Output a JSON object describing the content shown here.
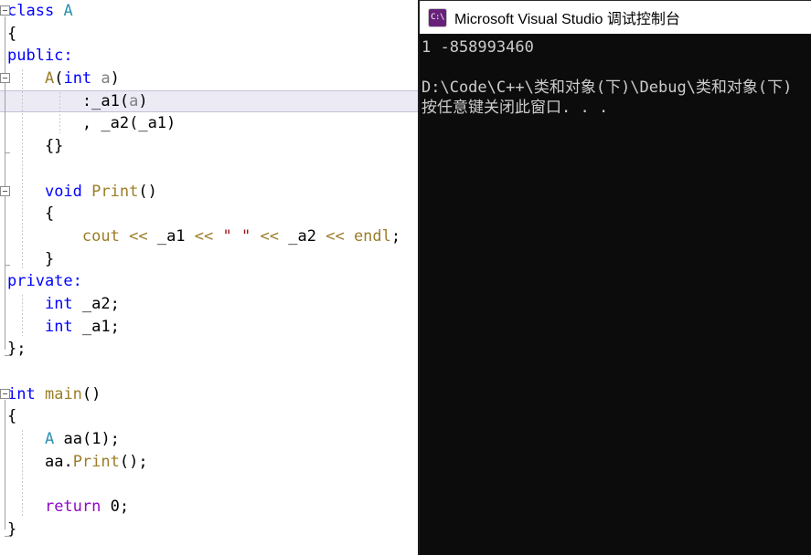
{
  "editor": {
    "name": "code-editor",
    "language": "cpp",
    "current_line_index": 4,
    "lines": [
      {
        "fold": "start",
        "indent": 0,
        "tokens": [
          {
            "t": "class",
            "c": "kw"
          },
          {
            "t": " ",
            "c": "plain"
          },
          {
            "t": "A",
            "c": "type"
          }
        ]
      },
      {
        "fold": "mid",
        "indent": 0,
        "tokens": [
          {
            "t": "{",
            "c": "plain"
          }
        ]
      },
      {
        "fold": "mid",
        "indent": 0,
        "tokens": [
          {
            "t": "public",
            "c": "kw"
          },
          {
            "t": ":",
            "c": "kw"
          }
        ]
      },
      {
        "fold": "start",
        "indent": 1,
        "tokens": [
          {
            "t": "    ",
            "c": "plain"
          },
          {
            "t": "A",
            "c": "fn"
          },
          {
            "t": "(",
            "c": "plain"
          },
          {
            "t": "int",
            "c": "kw"
          },
          {
            "t": " ",
            "c": "plain"
          },
          {
            "t": "a",
            "c": "param"
          },
          {
            "t": ")",
            "c": "plain"
          }
        ]
      },
      {
        "fold": "mid",
        "indent": 2,
        "tokens": [
          {
            "t": "        :",
            "c": "plain"
          },
          {
            "t": "_a1",
            "c": "plain"
          },
          {
            "t": "(",
            "c": "plain"
          },
          {
            "t": "a",
            "c": "param"
          },
          {
            "t": ")",
            "c": "plain"
          }
        ]
      },
      {
        "fold": "mid",
        "indent": 2,
        "tokens": [
          {
            "t": "        , ",
            "c": "plain"
          },
          {
            "t": "_a2",
            "c": "plain"
          },
          {
            "t": "(",
            "c": "plain"
          },
          {
            "t": "_a1",
            "c": "plain"
          },
          {
            "t": ")",
            "c": "plain"
          }
        ]
      },
      {
        "fold": "end",
        "indent": 1,
        "tokens": [
          {
            "t": "    {}",
            "c": "plain"
          }
        ]
      },
      {
        "fold": "mid",
        "indent": 1,
        "tokens": [
          {
            "t": "",
            "c": "plain"
          }
        ]
      },
      {
        "fold": "start",
        "indent": 1,
        "tokens": [
          {
            "t": "    ",
            "c": "plain"
          },
          {
            "t": "void",
            "c": "kw"
          },
          {
            "t": " ",
            "c": "plain"
          },
          {
            "t": "Print",
            "c": "fn"
          },
          {
            "t": "()",
            "c": "plain"
          }
        ]
      },
      {
        "fold": "mid",
        "indent": 1,
        "tokens": [
          {
            "t": "    {",
            "c": "plain"
          }
        ]
      },
      {
        "fold": "mid",
        "indent": 2,
        "tokens": [
          {
            "t": "        ",
            "c": "plain"
          },
          {
            "t": "cout",
            "c": "op"
          },
          {
            "t": " ",
            "c": "plain"
          },
          {
            "t": "<<",
            "c": "op"
          },
          {
            "t": " ",
            "c": "plain"
          },
          {
            "t": "_a1",
            "c": "plain"
          },
          {
            "t": " ",
            "c": "plain"
          },
          {
            "t": "<<",
            "c": "op"
          },
          {
            "t": " ",
            "c": "plain"
          },
          {
            "t": "\" \"",
            "c": "str"
          },
          {
            "t": " ",
            "c": "plain"
          },
          {
            "t": "<<",
            "c": "op"
          },
          {
            "t": " ",
            "c": "plain"
          },
          {
            "t": "_a2",
            "c": "plain"
          },
          {
            "t": " ",
            "c": "plain"
          },
          {
            "t": "<<",
            "c": "op"
          },
          {
            "t": " ",
            "c": "plain"
          },
          {
            "t": "endl",
            "c": "op"
          },
          {
            "t": ";",
            "c": "plain"
          }
        ]
      },
      {
        "fold": "end",
        "indent": 1,
        "tokens": [
          {
            "t": "    }",
            "c": "plain"
          }
        ]
      },
      {
        "fold": "mid",
        "indent": 0,
        "tokens": [
          {
            "t": "private",
            "c": "kw"
          },
          {
            "t": ":",
            "c": "kw"
          }
        ]
      },
      {
        "fold": "mid",
        "indent": 1,
        "tokens": [
          {
            "t": "    ",
            "c": "plain"
          },
          {
            "t": "int",
            "c": "kw"
          },
          {
            "t": " ",
            "c": "plain"
          },
          {
            "t": "_a2",
            "c": "plain"
          },
          {
            "t": ";",
            "c": "plain"
          }
        ]
      },
      {
        "fold": "mid",
        "indent": 1,
        "tokens": [
          {
            "t": "    ",
            "c": "plain"
          },
          {
            "t": "int",
            "c": "kw"
          },
          {
            "t": " ",
            "c": "plain"
          },
          {
            "t": "_a1",
            "c": "plain"
          },
          {
            "t": ";",
            "c": "plain"
          }
        ]
      },
      {
        "fold": "end",
        "indent": 0,
        "tokens": [
          {
            "t": "};",
            "c": "plain"
          }
        ]
      },
      {
        "fold": "none",
        "indent": 0,
        "tokens": [
          {
            "t": "",
            "c": "plain"
          }
        ]
      },
      {
        "fold": "start",
        "indent": 0,
        "tokens": [
          {
            "t": "int",
            "c": "kw"
          },
          {
            "t": " ",
            "c": "plain"
          },
          {
            "t": "main",
            "c": "fn"
          },
          {
            "t": "()",
            "c": "plain"
          }
        ]
      },
      {
        "fold": "mid",
        "indent": 0,
        "tokens": [
          {
            "t": "{",
            "c": "plain"
          }
        ]
      },
      {
        "fold": "mid",
        "indent": 1,
        "tokens": [
          {
            "t": "    ",
            "c": "plain"
          },
          {
            "t": "A",
            "c": "type"
          },
          {
            "t": " ",
            "c": "plain"
          },
          {
            "t": "aa",
            "c": "plain"
          },
          {
            "t": "(",
            "c": "plain"
          },
          {
            "t": "1",
            "c": "num"
          },
          {
            "t": ");",
            "c": "plain"
          }
        ]
      },
      {
        "fold": "mid",
        "indent": 1,
        "tokens": [
          {
            "t": "    ",
            "c": "plain"
          },
          {
            "t": "aa",
            "c": "plain"
          },
          {
            "t": ".",
            "c": "plain"
          },
          {
            "t": "Print",
            "c": "fn"
          },
          {
            "t": "();",
            "c": "plain"
          }
        ]
      },
      {
        "fold": "mid",
        "indent": 1,
        "tokens": [
          {
            "t": "",
            "c": "plain"
          }
        ]
      },
      {
        "fold": "mid",
        "indent": 1,
        "tokens": [
          {
            "t": "    ",
            "c": "plain"
          },
          {
            "t": "return",
            "c": "ctrl"
          },
          {
            "t": " ",
            "c": "plain"
          },
          {
            "t": "0",
            "c": "num"
          },
          {
            "t": ";",
            "c": "plain"
          }
        ]
      },
      {
        "fold": "end",
        "indent": 0,
        "tokens": [
          {
            "t": "}",
            "c": "plain"
          }
        ]
      }
    ]
  },
  "console": {
    "icon_name": "vs-debug-console-icon",
    "icon_glyph": "C:\\",
    "icon_color": "#68217a",
    "title": "Microsoft Visual Studio 调试控制台",
    "background": "#0c0c0c",
    "text_color": "#cccccc",
    "lines": [
      "1 -858993460",
      "",
      "D:\\Code\\C++\\类和对象(下)\\Debug\\类和对象(下)",
      "按任意键关闭此窗口. . ."
    ]
  }
}
